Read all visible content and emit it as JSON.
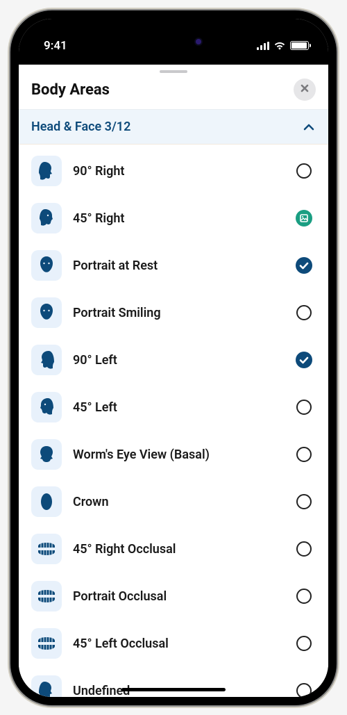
{
  "status": {
    "time": "9:41"
  },
  "sheet": {
    "title": "Body Areas"
  },
  "section": {
    "label": "Head & Face 3/12"
  },
  "items": [
    {
      "label": "90° Right",
      "icon": "head-right-90",
      "state": "empty"
    },
    {
      "label": "45° Right",
      "icon": "head-right-45",
      "state": "image"
    },
    {
      "label": "Portrait at Rest",
      "icon": "head-front",
      "state": "checked"
    },
    {
      "label": "Portrait Smiling",
      "icon": "head-front",
      "state": "empty"
    },
    {
      "label": "90° Left",
      "icon": "head-left-90",
      "state": "checked"
    },
    {
      "label": "45° Left",
      "icon": "head-left-45",
      "state": "empty"
    },
    {
      "label": "Worm's Eye View (Basal)",
      "icon": "head-basal",
      "state": "empty"
    },
    {
      "label": "Crown",
      "icon": "head-crown",
      "state": "empty"
    },
    {
      "label": "45° Right Occlusal",
      "icon": "teeth",
      "state": "empty"
    },
    {
      "label": "Portrait Occlusal",
      "icon": "teeth",
      "state": "empty"
    },
    {
      "label": "45° Left Occlusal",
      "icon": "teeth",
      "state": "empty"
    },
    {
      "label": "Undefined",
      "icon": "head-right-90",
      "state": "empty"
    }
  ]
}
